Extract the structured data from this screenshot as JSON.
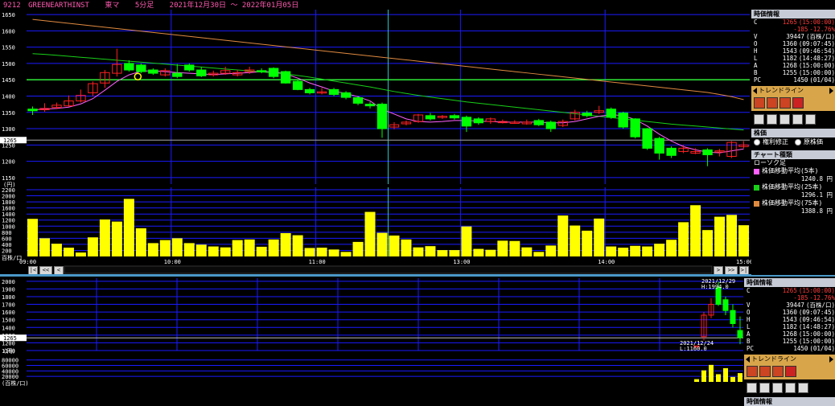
{
  "header": {
    "code": "9212",
    "name": "GREENEARTHINST",
    "market": "東マ",
    "interval": "5分足",
    "period": "2021年12月30日 〜 2022年01月05日"
  },
  "colors": {
    "up_candle": "#ff2020",
    "down_candle": "#00ff00",
    "volume": "#ffff00",
    "ma5": "#ff60ff",
    "ma25": "#18d018",
    "ma75": "#e08a40",
    "grid": "#1a1aff",
    "hline": "#33ff33"
  },
  "chart_data": [
    {
      "type": "candlestick",
      "x": [
        "09:00",
        "09:05",
        "09:10",
        "09:15",
        "09:20",
        "09:25",
        "09:30",
        "09:35",
        "09:40",
        "09:45",
        "09:50",
        "09:55",
        "10:00",
        "10:05",
        "10:10",
        "10:15",
        "10:20",
        "10:25",
        "10:30",
        "10:35",
        "10:40",
        "10:45",
        "10:50",
        "10:55",
        "11:00",
        "11:05",
        "11:10",
        "11:15",
        "11:20",
        "11:25",
        "12:30",
        "12:35",
        "12:40",
        "12:45",
        "12:50",
        "12:55",
        "13:00",
        "13:05",
        "13:10",
        "13:15",
        "13:20",
        "13:25",
        "13:30",
        "13:35",
        "13:40",
        "13:45",
        "13:50",
        "13:55",
        "14:00",
        "14:05",
        "14:10",
        "14:15",
        "14:20",
        "14:25",
        "14:30",
        "14:35",
        "14:40",
        "14:45",
        "14:50",
        "14:55"
      ],
      "open": [
        1360,
        1358,
        1365,
        1370,
        1385,
        1410,
        1440,
        1470,
        1500,
        1495,
        1480,
        1465,
        1470,
        1495,
        1480,
        1465,
        1470,
        1465,
        1475,
        1478,
        1485,
        1475,
        1445,
        1420,
        1410,
        1420,
        1410,
        1395,
        1375,
        1375,
        1305,
        1315,
        1322,
        1340,
        1335,
        1340,
        1335,
        1330,
        1322,
        1320,
        1318,
        1315,
        1325,
        1320,
        1310,
        1330,
        1348,
        1350,
        1360,
        1348,
        1330,
        1300,
        1270,
        1240,
        1230,
        1225,
        1235,
        1230,
        1215,
        1245
      ],
      "close": [
        1355,
        1362,
        1372,
        1385,
        1402,
        1438,
        1472,
        1497,
        1480,
        1475,
        1470,
        1478,
        1460,
        1480,
        1462,
        1470,
        1478,
        1472,
        1480,
        1474,
        1460,
        1440,
        1420,
        1410,
        1413,
        1405,
        1396,
        1378,
        1370,
        1300,
        1312,
        1320,
        1342,
        1330,
        1338,
        1333,
        1308,
        1318,
        1330,
        1322,
        1320,
        1320,
        1312,
        1300,
        1322,
        1350,
        1340,
        1355,
        1335,
        1305,
        1275,
        1240,
        1225,
        1218,
        1240,
        1230,
        1220,
        1232,
        1258,
        1250
      ],
      "high": [
        1368,
        1378,
        1380,
        1402,
        1420,
        1445,
        1480,
        1545,
        1510,
        1500,
        1485,
        1485,
        1498,
        1500,
        1490,
        1478,
        1490,
        1480,
        1490,
        1485,
        1488,
        1478,
        1450,
        1425,
        1425,
        1425,
        1415,
        1400,
        1382,
        1380,
        1320,
        1325,
        1345,
        1348,
        1342,
        1345,
        1340,
        1335,
        1334,
        1328,
        1326,
        1328,
        1330,
        1325,
        1328,
        1358,
        1355,
        1370,
        1365,
        1352,
        1332,
        1302,
        1275,
        1246,
        1250,
        1240,
        1240,
        1238,
        1262,
        1262
      ],
      "low": [
        1342,
        1352,
        1360,
        1368,
        1380,
        1400,
        1425,
        1460,
        1475,
        1470,
        1465,
        1460,
        1455,
        1475,
        1458,
        1460,
        1465,
        1460,
        1468,
        1470,
        1455,
        1438,
        1418,
        1405,
        1405,
        1400,
        1390,
        1372,
        1362,
        1272,
        1298,
        1310,
        1318,
        1325,
        1330,
        1328,
        1290,
        1312,
        1315,
        1316,
        1315,
        1312,
        1308,
        1290,
        1305,
        1325,
        1335,
        1345,
        1330,
        1300,
        1270,
        1235,
        1205,
        1210,
        1225,
        1222,
        1185,
        1215,
        1210,
        1240
      ],
      "ma5": [
        1358,
        1360,
        1362,
        1366,
        1376,
        1392,
        1418,
        1445,
        1465,
        1476,
        1478,
        1475,
        1472,
        1470,
        1468,
        1466,
        1468,
        1470,
        1472,
        1475,
        1475,
        1468,
        1455,
        1440,
        1428,
        1415,
        1408,
        1398,
        1385,
        1360,
        1345,
        1330,
        1322,
        1320,
        1322,
        1325,
        1325,
        1323,
        1322,
        1320,
        1320,
        1320,
        1320,
        1318,
        1318,
        1322,
        1330,
        1338,
        1343,
        1340,
        1328,
        1308,
        1283,
        1262,
        1245,
        1235,
        1228,
        1226,
        1232,
        1238
      ],
      "ma25": [
        1530,
        1528,
        1525,
        1522,
        1519,
        1516,
        1513,
        1510,
        1507,
        1504,
        1501,
        1498,
        1495,
        1492,
        1489,
        1486,
        1483,
        1480,
        1477,
        1474,
        1471,
        1468,
        1463,
        1458,
        1452,
        1446,
        1440,
        1434,
        1428,
        1421,
        1414,
        1408,
        1402,
        1397,
        1392,
        1387,
        1382,
        1378,
        1374,
        1370,
        1366,
        1362,
        1358,
        1354,
        1350,
        1346,
        1342,
        1338,
        1334,
        1330,
        1326,
        1322,
        1318,
        1314,
        1311,
        1308,
        1305,
        1302,
        1299,
        1296
      ],
      "ma75": [
        1635,
        1631,
        1627,
        1623,
        1619,
        1615,
        1611,
        1607,
        1603,
        1599,
        1595,
        1591,
        1587,
        1583,
        1579,
        1575,
        1571,
        1567,
        1563,
        1559,
        1555,
        1551,
        1547,
        1543,
        1539,
        1535,
        1531,
        1527,
        1523,
        1519,
        1515,
        1511,
        1507,
        1503,
        1499,
        1495,
        1491,
        1487,
        1483,
        1479,
        1475,
        1471,
        1467,
        1463,
        1459,
        1455,
        1451,
        1447,
        1443,
        1439,
        1435,
        1431,
        1427,
        1423,
        1419,
        1415,
        1411,
        1405,
        1398,
        1389
      ],
      "volume": [
        1240,
        600,
        420,
        290,
        130,
        630,
        1220,
        1150,
        1900,
        930,
        440,
        540,
        600,
        440,
        390,
        330,
        300,
        540,
        560,
        320,
        560,
        770,
        700,
        280,
        290,
        230,
        150,
        480,
        1470,
        780,
        690,
        560,
        300,
        340,
        210,
        210,
        990,
        250,
        220,
        520,
        510,
        300,
        150,
        360,
        1350,
        1020,
        850,
        1250,
        330,
        290,
        350,
        330,
        420,
        550,
        1130,
        1690,
        870,
        1310,
        1370,
        1030
      ],
      "price_ticks": [
        1150,
        1200,
        1250,
        1300,
        1350,
        1400,
        1450,
        1500,
        1550,
        1600,
        1650
      ],
      "price_ylim": [
        1130,
        1665
      ],
      "volume_ticks": [
        200,
        400,
        600,
        800,
        1000,
        1200,
        1400,
        1600,
        1800,
        2000,
        2200
      ],
      "volume_ylim": [
        0,
        2280
      ],
      "time_labels": [
        "09:00",
        "10:00",
        "11:00",
        "13:00",
        "14:00",
        "15:00"
      ],
      "hline": 1450,
      "last_price": "1265",
      "price_axis_label": "(円)",
      "volume_axis_label": "百株/口",
      "cursor_label": "1265"
    },
    {
      "type": "candlestick",
      "x": [
        "12/24",
        "12/27",
        "12/28",
        "12/29",
        "12/30",
        "01/04",
        "01/05"
      ],
      "open": [
        1160,
        1280,
        1560,
        1915,
        1760,
        1620,
        1360
      ],
      "close": [
        1160,
        1560,
        1700,
        1700,
        1620,
        1450,
        1268
      ],
      "high": [
        1160,
        1600,
        1780,
        1994,
        1800,
        1700,
        1543
      ],
      "low": [
        1160,
        1230,
        1520,
        1680,
        1560,
        1400,
        1182
      ],
      "volume": [
        10000,
        42000,
        62000,
        28000,
        50000,
        18000,
        32000
      ],
      "price_ticks": [
        1100,
        1200,
        1300,
        1400,
        1500,
        1600,
        1700,
        1800,
        1900,
        2000
      ],
      "volume_ticks": [
        20000,
        40000,
        60000,
        80000
      ],
      "annotations": [
        {
          "date": "2021/12/29",
          "text": "H:1994.0"
        },
        {
          "date": "2021/12/24",
          "text": "L:1160.0"
        }
      ],
      "cursor_label": "1265",
      "price_axis_label": "(円)",
      "volume_axis_label": "(百株/口)"
    }
  ],
  "side_panel": {
    "info_title": "時価情報",
    "info": [
      {
        "k": "C",
        "v": "1265",
        "t": "(15:00:00)",
        "red": true
      },
      {
        "k": "",
        "v": "-185",
        "t": "-12.76%",
        "red": true
      },
      {
        "k": "V",
        "v": "39447",
        "t": "(百株/口)"
      },
      {
        "k": "O",
        "v": "1360",
        "t": "(09:07:45)"
      },
      {
        "k": "H",
        "v": "1543",
        "t": "(09:46:54)"
      },
      {
        "k": "L",
        "v": "1182",
        "t": "(14:48:27)"
      },
      {
        "k": "A",
        "v": "1268",
        "t": "(15:00:00)"
      },
      {
        "k": "B",
        "v": "1255",
        "t": "(15:00:00)"
      },
      {
        "k": "PC",
        "v": "1450",
        "t": "(01/04)"
      }
    ],
    "trendline_label": "トレンドライン",
    "price_title": "株価",
    "radio_a": "権利修正",
    "radio_b": "原株価",
    "chart_type_title": "チャート種類",
    "candle_label": "ローソク足",
    "ma": [
      {
        "label": "株価移動平均(5本)",
        "value": "1240.8",
        "unit": "円",
        "color": "#ff60ff"
      },
      {
        "label": "株価移動平均(25本)",
        "value": "1296.1",
        "unit": "円",
        "color": "#18d018"
      },
      {
        "label": "株価移動平均(75本)",
        "value": "1388.8",
        "unit": "円",
        "color": "#e08a40"
      }
    ],
    "bottom_title": "時価情報"
  },
  "nav": {
    "first": "|<",
    "prev_fast": "<<",
    "prev": "<",
    "next": ">",
    "next_fast": ">>",
    "last": ">|"
  }
}
